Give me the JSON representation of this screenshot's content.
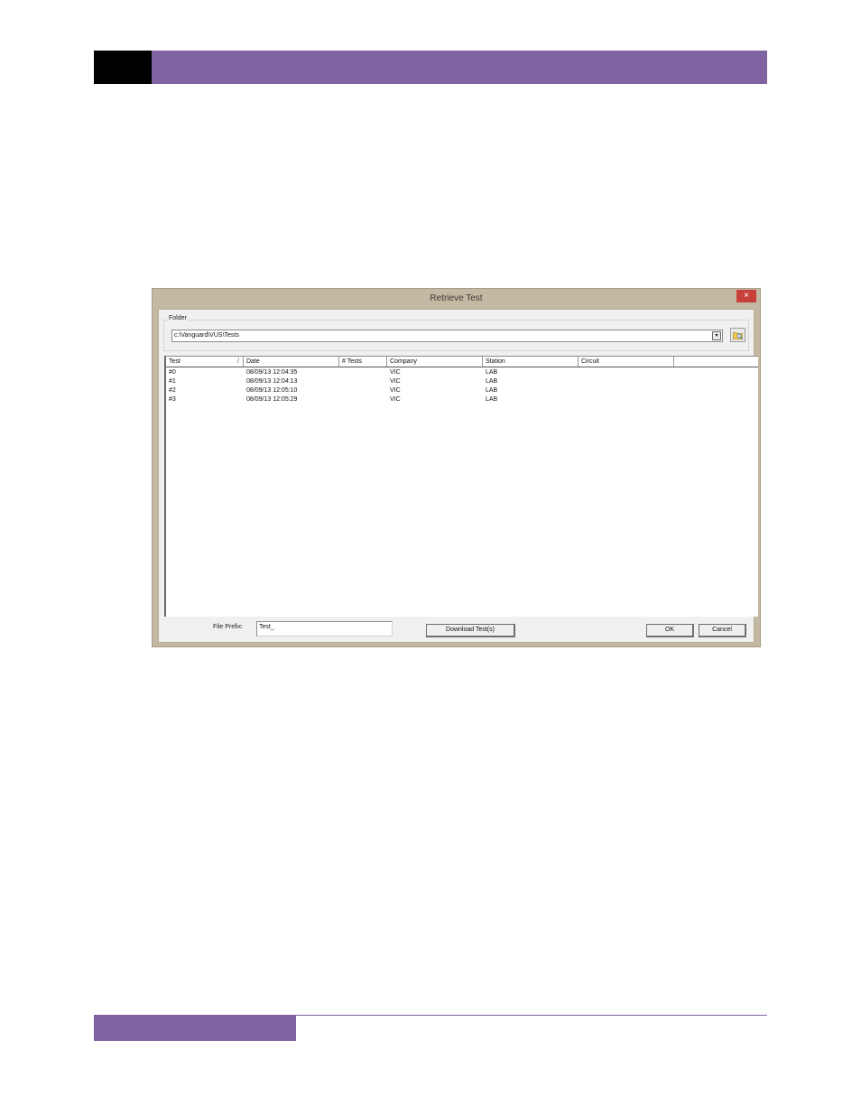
{
  "dialog": {
    "title": "Retrieve Test",
    "close_label": "×",
    "folder_legend": "Folder",
    "folder_path": "c:\\Vanguard\\VUS\\Tests",
    "combo_arrow": "▾",
    "columns": [
      "Test",
      "Date",
      "# Tests",
      "Company",
      "Station",
      "Circuit"
    ],
    "sort_indicator": "/",
    "rows": [
      {
        "test": "#0",
        "date": "08/09/13 12:04:35",
        "tests": "",
        "company": "VIC",
        "station": "LAB",
        "circuit": ""
      },
      {
        "test": "#1",
        "date": "08/09/13 12:04:13",
        "tests": "",
        "company": "VIC",
        "station": "LAB",
        "circuit": ""
      },
      {
        "test": "#2",
        "date": "08/09/13 12:05:10",
        "tests": "",
        "company": "VIC",
        "station": "LAB",
        "circuit": ""
      },
      {
        "test": "#3",
        "date": "08/09/13 12:05:29",
        "tests": "",
        "company": "VIC",
        "station": "LAB",
        "circuit": ""
      }
    ],
    "file_prefix_label": "File Prefix:",
    "file_prefix_value": "Test_",
    "download_label": "Download Test(s)",
    "ok_label": "OK",
    "cancel_label": "Cancel"
  },
  "colors": {
    "accent_purple": "#8064a2",
    "window_frame": "#c3b8a1",
    "close_red": "#c7403a"
  }
}
